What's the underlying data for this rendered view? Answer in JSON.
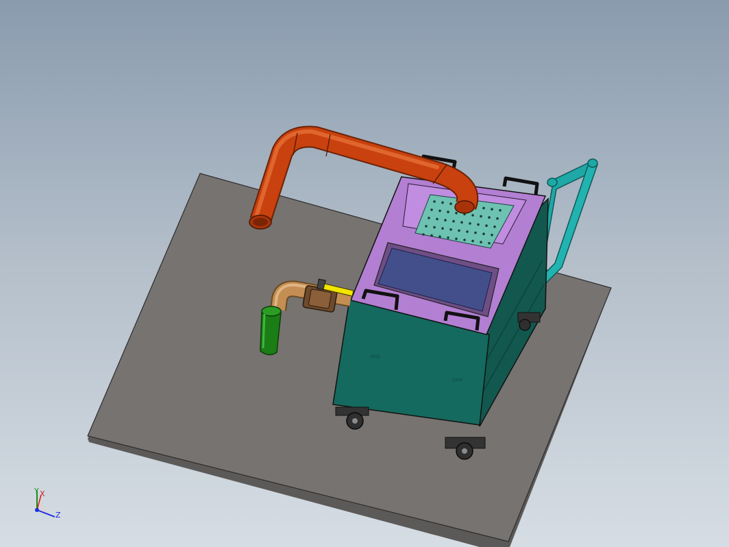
{
  "viewport": {
    "name": "3d-model-viewport"
  },
  "colors": {
    "background_top": "#8a9bae",
    "background_bottom": "#d6dde4",
    "base_plate": "#767370",
    "box_body": "#146a5e",
    "box_frame": "#b27fd2",
    "box_window": "#434f8a",
    "perforated_tray": "#6dc2b2",
    "orange_pipe": "#c8410e",
    "brass_pipe": "#c48e52",
    "green_pipe": "#1b7d16",
    "handle_bar": "#1ea8a6",
    "valve_handle": "#f2e500",
    "axis_x": "#d01c1c",
    "axis_y": "#1b8c1b",
    "axis_z": "#1b2ee0"
  },
  "triad": {
    "x_label": "X",
    "y_label": "Y",
    "z_label": "Z"
  }
}
